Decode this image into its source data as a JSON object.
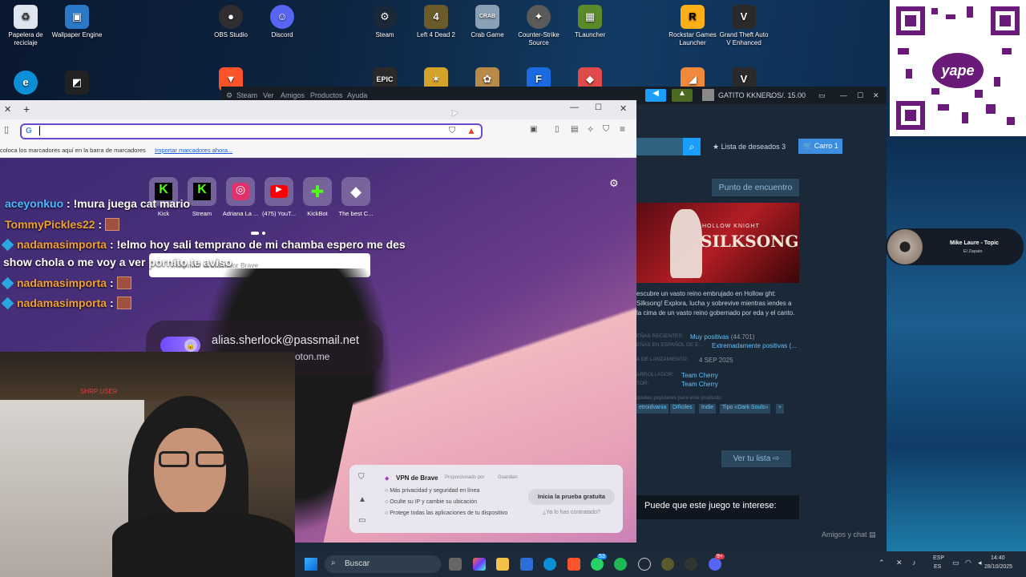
{
  "desktop_icons": [
    {
      "label": "Papelera de reciclaje",
      "icon": "recycle-bin-icon",
      "color": "#dfe6ef"
    },
    {
      "label": "Wallpaper Engine",
      "icon": "wallpaper-engine-icon",
      "color": "#2a78c8"
    },
    {
      "label": "OBS Studio",
      "icon": "obs-icon",
      "color": "#302e31"
    },
    {
      "label": "Discord",
      "icon": "discord-icon",
      "color": "#5865f2"
    },
    {
      "label": "Steam",
      "icon": "steam-icon",
      "color": "#1b2838"
    },
    {
      "label": "Left 4 Dead 2",
      "icon": "l4d2-icon",
      "color": "#6b5a2a"
    },
    {
      "label": "Crab Game",
      "icon": "crab-game-icon",
      "color": "#8aa0b5"
    },
    {
      "label": "Counter-Strike Source",
      "icon": "css-icon",
      "color": "#5a5a5a"
    },
    {
      "label": "TLauncher",
      "icon": "tlauncher-icon",
      "color": "#5a8a2a"
    },
    {
      "label": "Rockstar Games Launcher",
      "icon": "rockstar-icon",
      "color": "#fcaf17"
    },
    {
      "label": "Grand Theft Auto V Enhanced",
      "icon": "gta-icon",
      "color": "#2a2a2a"
    }
  ],
  "qr": {
    "brand": "yape"
  },
  "steam": {
    "menu": [
      "Steam",
      "Ver",
      "Amigos",
      "Productos",
      "Ayuda"
    ],
    "user": "GATITO KKNERO",
    "balance": "S/. 15.00",
    "wishlist_label": "Lista de deseados",
    "wishlist_count": "3",
    "cart_label": "Carro",
    "cart_count": "1",
    "meeting_point": "Punto de encuentro",
    "game_title_art": "SILKSONG",
    "game_subtitle_art": "HOLLOW KNIGHT",
    "description": "escubre un vasto reino embrujado en Hollow ght: Silksong! Explora, lucha y sobrevive mientras iendes a la cima de un vasto reino gobernado por eda y el canto.",
    "reviews_recent_label": "EÑAS RECIENTES:",
    "reviews_recent_value": "Muy positivas",
    "reviews_recent_count": "(44.701)",
    "reviews_es_label": "EÑAS EN ESPAÑOL DE E...",
    "reviews_es_value": "Extremadamente positivas (...",
    "release_label": "A DE LANZAMIENTO:",
    "release_value": "4 SEP 2025",
    "dev_label": "ARROLLADOR:",
    "dev_value": "Team Cherry",
    "pub_label": "TOR:",
    "pub_value": "Team Cherry",
    "tags_label": "quetas populares para este producto:",
    "tags": [
      "etroidvania",
      "Difíciles",
      "Indie",
      "Tipo «Dark Souls»",
      "+"
    ],
    "view_list": "Ver tu lista",
    "suggest": "Puede que este juego te interese:",
    "friends_chat": "Amigos y chat"
  },
  "brave": {
    "bookmarks_hint": "coloca los marcadores aquí en la barra de marcadores",
    "import_bookmarks": "Importar marcadores ahora...",
    "shortcuts": [
      {
        "label": "Kick",
        "color": "#53fc18"
      },
      {
        "label": "Stream",
        "color": "#53fc18"
      },
      {
        "label": "Adriana La ...",
        "color": "#e1306c"
      },
      {
        "label": "(475) YouT...",
        "color": "#ff0000"
      },
      {
        "label": "KickBot",
        "color": "#53fc18"
      },
      {
        "label": "The best C...",
        "color": "#ffffff"
      }
    ],
    "search_placeholder": "Preguntar al buscador Brave",
    "email": "alias.sherlock@passmail.net",
    "email_domain": "oton.me",
    "vpn_title": "VPN de Brave",
    "vpn_sponsor": "Proporcionado por",
    "vpn_partner": "Guardian",
    "vpn_features": [
      "Más privacidad y seguridad en línea",
      "Oculte su IP y cambie su ubicación",
      "Protege todas las aplicaciones de tu dispositivo"
    ],
    "vpn_cta": "Inicia la prueba gratuita",
    "vpn_link": "¿Ya lo has contratado?"
  },
  "chat": [
    {
      "user": "aceyonkuo",
      "color": "#4db8ff",
      "text": ": !mura juega cat mario",
      "badge": false,
      "emote": false
    },
    {
      "user": "TommyPickles22",
      "color": "#f0a030",
      "text": ":",
      "badge": false,
      "emote": true
    },
    {
      "user": "nadamasimporta",
      "color": "#f0a030",
      "text": ": !elmo hoy sali temprano de mi chamba espero me des",
      "badge": true,
      "emote": false
    },
    {
      "user": "",
      "color": "#ffffff",
      "text": "show chola o me voy a ver pornito te aviso",
      "badge": false,
      "emote": false
    },
    {
      "user": "nadamasimporta",
      "color": "#f0a030",
      "text": ":",
      "badge": true,
      "emote": true
    },
    {
      "user": "nadamasimporta",
      "color": "#f0a030",
      "text": ":",
      "badge": true,
      "emote": true
    }
  ],
  "cam": {
    "label": "SHRP USER"
  },
  "music": {
    "title": "Mike Laure - Topic",
    "subtitle": "El Zapato"
  },
  "taskbar": {
    "search": "Buscar",
    "lang": "ESP",
    "region": "ES",
    "time": "14:40",
    "date": "28/10/2025",
    "whatsapp_badge": "53",
    "discord_badge": "9+"
  }
}
